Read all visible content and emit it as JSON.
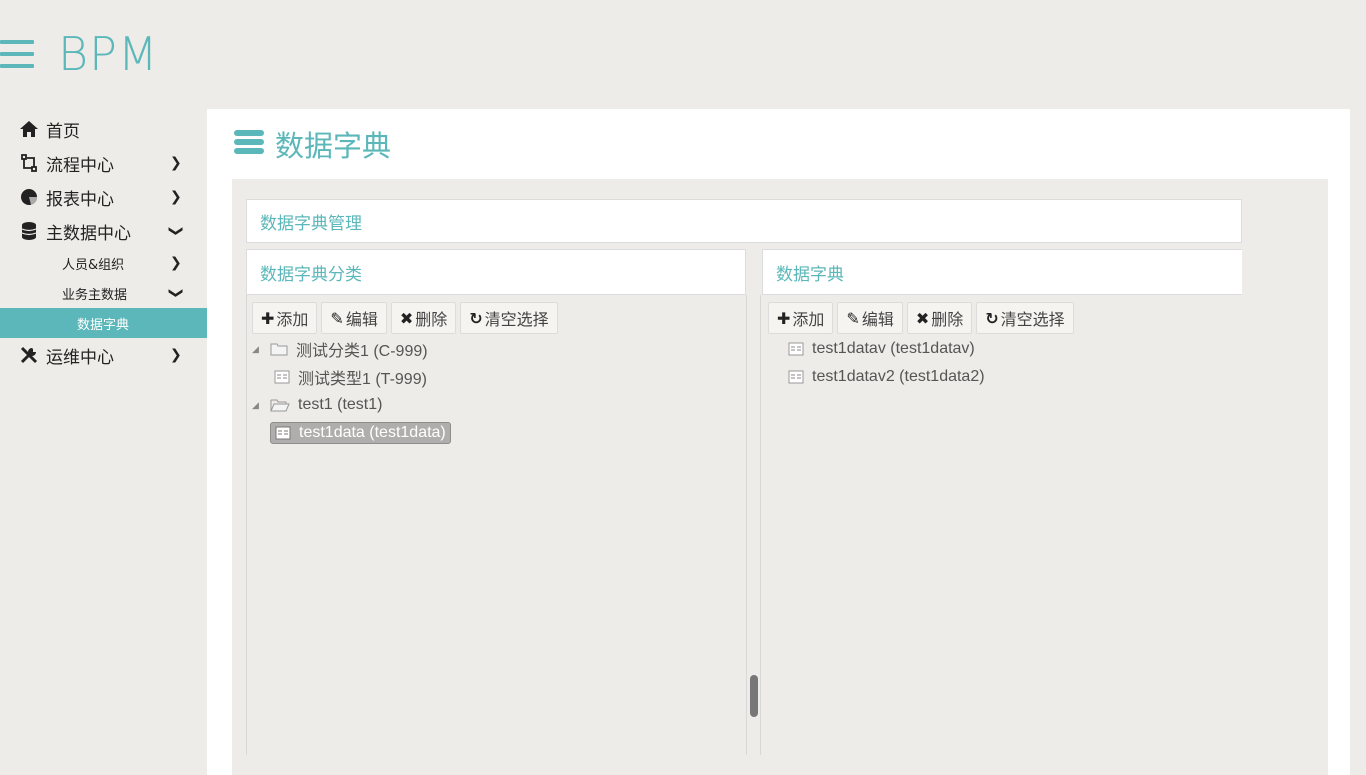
{
  "brand": {
    "title": "BPM"
  },
  "sidebar": {
    "items": [
      {
        "label": "首页",
        "icon": "home-icon"
      },
      {
        "label": "流程中心",
        "icon": "process-icon"
      },
      {
        "label": "报表中心",
        "icon": "pie-chart-icon"
      },
      {
        "label": "主数据中心",
        "icon": "database-icon"
      },
      {
        "label": "人员&组织"
      },
      {
        "label": "业务主数据"
      },
      {
        "label": "数据字典"
      },
      {
        "label": "运维中心",
        "icon": "tools-icon"
      }
    ]
  },
  "page": {
    "title": "数据字典"
  },
  "panels": {
    "manage_title": "数据字典管理",
    "left_title": "数据字典分类",
    "right_title": "数据字典"
  },
  "toolbar": {
    "add": "添加",
    "edit": "编辑",
    "delete": "删除",
    "clear": "清空选择"
  },
  "left_tree": [
    {
      "label": "测试分类1 (C-999)",
      "children": [
        {
          "label": "测试类型1 (T-999)"
        }
      ]
    },
    {
      "label": "test1 (test1)",
      "children": [
        {
          "label": "test1data (test1data)",
          "selected": true
        }
      ]
    }
  ],
  "right_list": [
    {
      "label": "test1datav (test1datav)"
    },
    {
      "label": "test1datav2 (test1data2)"
    }
  ],
  "colors": {
    "accent": "#5bb7b9",
    "background": "#eeece8"
  }
}
